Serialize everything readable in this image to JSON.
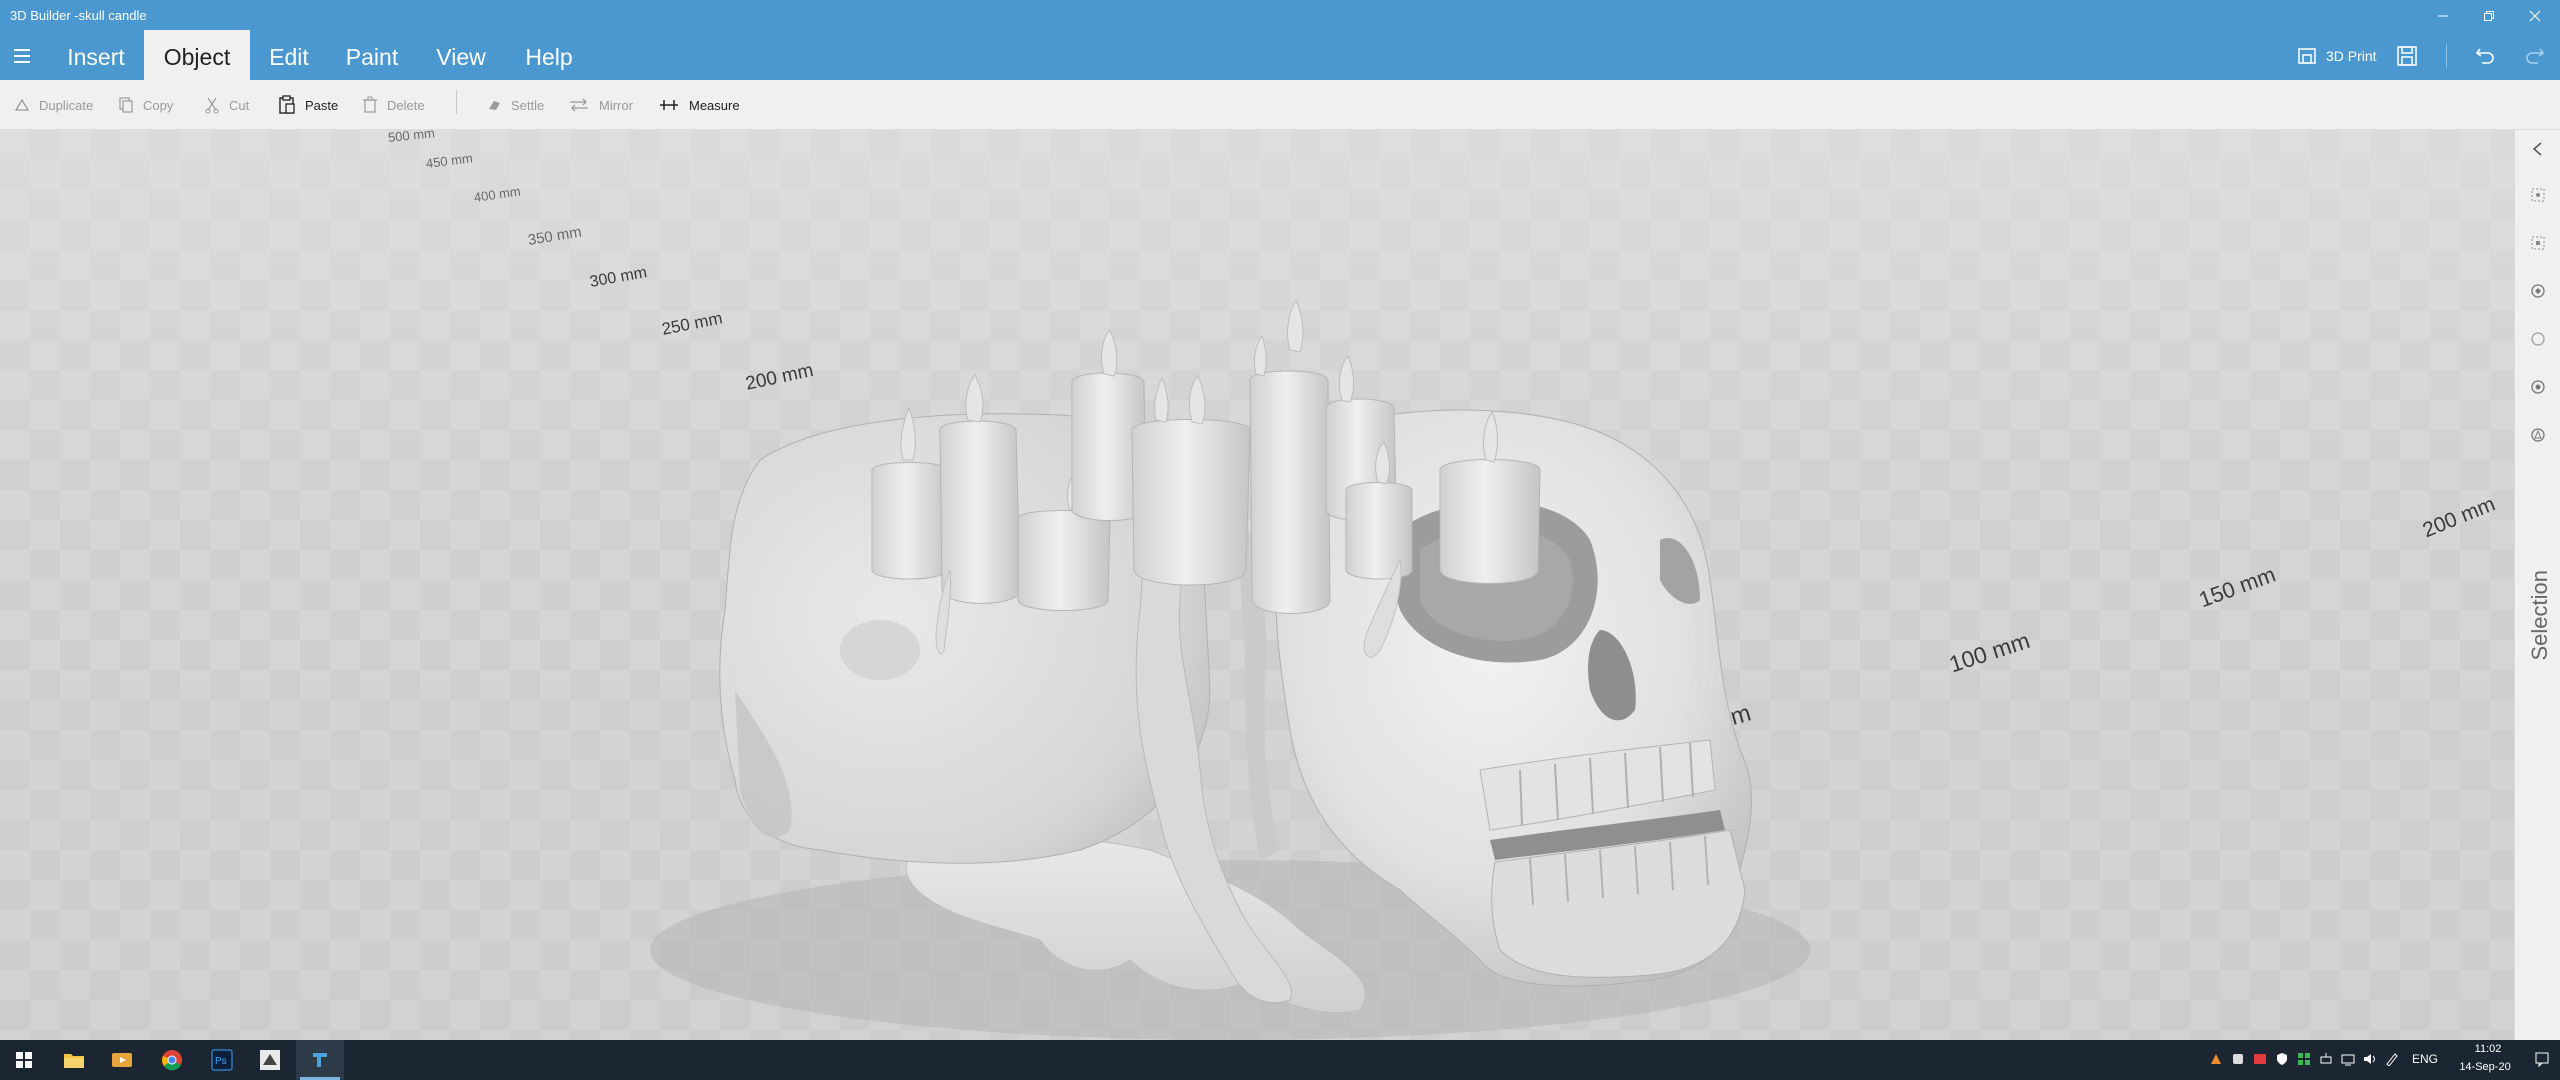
{
  "window": {
    "title": "3D Builder -skull candle",
    "controls": {
      "minimize": "minimize-icon",
      "restore": "restore-icon",
      "close": "close-icon"
    }
  },
  "menu": {
    "tabs": [
      {
        "label": "Insert"
      },
      {
        "label": "Object",
        "active": true
      },
      {
        "label": "Edit"
      },
      {
        "label": "Paint"
      },
      {
        "label": "View"
      },
      {
        "label": "Help"
      }
    ],
    "print_label": "3D Print"
  },
  "toolbar": {
    "duplicate": "Duplicate",
    "copy": "Copy",
    "cut": "Cut",
    "paste": "Paste",
    "delete": "Delete",
    "settle": "Settle",
    "mirror": "Mirror",
    "measure": "Measure"
  },
  "viewport": {
    "rulers_left": [
      "500 mm",
      "450 mm",
      "400 mm",
      "350 mm",
      "300 mm",
      "250 mm",
      "200 mm"
    ],
    "rulers_right": [
      "200 mm",
      "150 mm",
      "100 mm",
      "mm"
    ],
    "model_name": "skull candle"
  },
  "right_panel": {
    "selection_label": "Selection"
  },
  "taskbar": {
    "language": "ENG",
    "time": "11:02",
    "date": "14-Sep-20"
  },
  "colors": {
    "header": "#4a98cf",
    "toolbar": "#f0f0f0",
    "taskbar": "#1b2632",
    "model": "#e6e6e6"
  }
}
